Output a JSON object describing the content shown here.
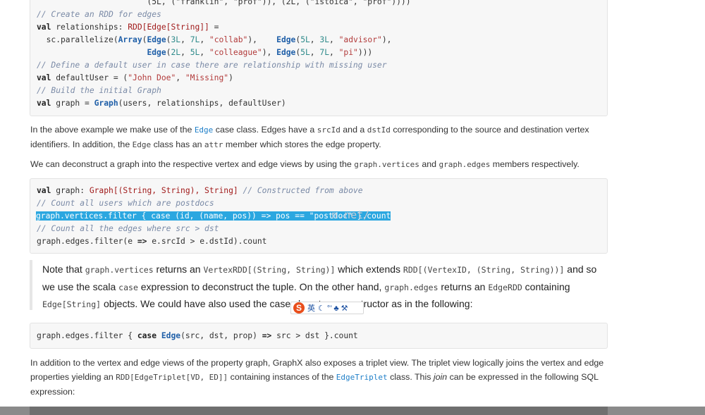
{
  "code1": {
    "line0": "(5L, (\"franklin\", \"prof\")), (2L, (\"istoica\", \"prof\"))))",
    "line1": "// Create an RDD for edges",
    "line2_kw": "val",
    "line2_a": " relationships: ",
    "line2_ty": "RDD[Edge[String]]",
    "line2_b": " =",
    "line3_a": "  sc.parallelize(",
    "line3_arr": "Array",
    "line3_b": "(",
    "line3_e1": "Edge",
    "line3_c": "(",
    "line3_n1": "3L",
    "line3_d": ", ",
    "line3_n2": "7L",
    "line3_e": ", ",
    "line3_s1": "\"collab\"",
    "line3_f": "),    ",
    "line3_e2": "Edge",
    "line3_g": "(",
    "line3_n3": "5L",
    "line3_h": ", ",
    "line3_n4": "3L",
    "line3_i": ", ",
    "line3_s2": "\"advisor\"",
    "line3_j": "),",
    "line4_a": "                       ",
    "line4_e1": "Edge",
    "line4_b": "(",
    "line4_n1": "2L",
    "line4_c": ", ",
    "line4_n2": "5L",
    "line4_d": ", ",
    "line4_s1": "\"colleague\"",
    "line4_e": "), ",
    "line4_e2": "Edge",
    "line4_f": "(",
    "line4_n3": "5L",
    "line4_g": ", ",
    "line4_n4": "7L",
    "line4_h": ", ",
    "line4_s2": "\"pi\"",
    "line4_i": ")))",
    "line5": "// Define a default user in case there are relationship with missing user",
    "line6_kw": "val",
    "line6_a": " defaultUser = (",
    "line6_s1": "\"John Doe\"",
    "line6_b": ", ",
    "line6_s2": "\"Missing\"",
    "line6_c": ")",
    "line7": "// Build the initial Graph",
    "line8_kw": "val",
    "line8_a": " graph = ",
    "line8_cl": "Graph",
    "line8_b": "(users, relationships, defaultUser)"
  },
  "para1": {
    "t1": "In the above example we make use of the ",
    "c1": "Edge",
    "t2": " case class. Edges have a ",
    "c2": "srcId",
    "t3": " and a ",
    "c3": "dstId",
    "t4": " corresponding to the source and destination vertex identifiers. In addition, the ",
    "c4": "Edge",
    "t5": " class has an ",
    "c5": "attr",
    "t6": " member which stores the edge property."
  },
  "para2": {
    "t1": "We can deconstruct a graph into the respective vertex and edge views by using the ",
    "c1": "graph.vertices",
    "t2": " and ",
    "c2": "graph.edges",
    "t3": " members respectively."
  },
  "code2": {
    "line1_kw": "val",
    "line1_a": " graph: ",
    "line1_ty": "Graph[(String, String), String]",
    "line1_cm": " // Constructed from above",
    "line2": "// Count all users which are postdocs",
    "line3": "graph.vertices.filter { case (id, (name, pos)) => pos == \"postdoc\" }.count",
    "line4": "// Count all the edges where src > dst",
    "line5_a": "graph.edges.filter(e ",
    "line5_kw": "=>",
    "line5_b": " e.srcId > e.dstId).count"
  },
  "watermark": "n.net/",
  "note": {
    "t1": "Note that ",
    "c1": "graph.vertices",
    "t2": " returns an ",
    "c2": "VertexRDD[(String, String)]",
    "t3": " which extends ",
    "c3": "RDD[(VertexID, (String, String))]",
    "t4": " and so we use the scala ",
    "c4": "case",
    "t5": " expression to deconstruct the tuple. On the other hand, ",
    "c5": "graph.edges",
    "t6": " returns an ",
    "c6": "EdgeRDD",
    "t7": " containing ",
    "c7": "Edge[String]",
    "t8": " objects. We could have also used the case class type constructor as in the following:"
  },
  "ime": {
    "logo": "S",
    "lang": "英",
    "icons": "☾ °’ ♣ ⚒"
  },
  "code3": {
    "a": "graph.edges.filter { ",
    "kw1": "case",
    "b": " ",
    "cl": "Edge",
    "c": "(src, dst, prop) ",
    "kw2": "=>",
    "d": " src > dst }.count"
  },
  "para3": {
    "t1": "In addition to the vertex and edge views of the property graph, GraphX also exposes a triplet view. The triplet view logically joins the vertex and edge properties yielding an ",
    "c1": "RDD[EdgeTriplet[VD, ED]]",
    "t2": " containing instances of the ",
    "c2": "EdgeTriplet",
    "t3": " class. This ",
    "em": "join",
    "t4": " can be expressed in the following SQL expression:"
  }
}
